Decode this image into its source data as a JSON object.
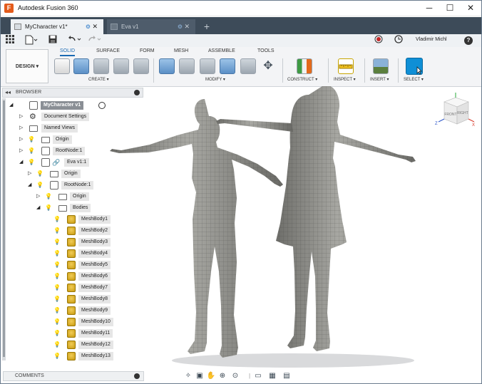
{
  "window": {
    "app_title": "Autodesk Fusion 360",
    "icon_letter": "F",
    "minimize": "─",
    "maximize": "☐",
    "close": "✕"
  },
  "tabs": [
    {
      "label": "MyCharacter v1*",
      "active": true
    },
    {
      "label": "Eva v1",
      "active": false
    }
  ],
  "tab_add": "+",
  "quick_access": {
    "user": "Vladimir Michl",
    "help": "?"
  },
  "toolbar": {
    "workspace": "DESIGN",
    "workspace_tabs": [
      "SOLID",
      "SURFACE",
      "FORM",
      "MESH",
      "ASSEMBLE",
      "TOOLS"
    ],
    "groups": [
      "CREATE",
      "MODIFY",
      "CONSTRUCT",
      "INSPECT",
      "INSERT",
      "SELECT"
    ]
  },
  "browser": {
    "title": "BROWSER",
    "root": "MyCharacter v1",
    "items": [
      "Document Settings",
      "Named Views",
      "Origin",
      "RootNode:1",
      "Eva v1:1",
      "Origin",
      "RootNode:1",
      "Origin",
      "Bodies"
    ],
    "bodies": [
      "MeshBody1",
      "MeshBody2",
      "MeshBody3",
      "MeshBody4",
      "MeshBody5",
      "MeshBody6",
      "MeshBody7",
      "MeshBody8",
      "MeshBody9",
      "MeshBody10",
      "MeshBody11",
      "MeshBody12",
      "MeshBody13"
    ]
  },
  "comments": {
    "label": "COMMENTS"
  },
  "viewcube": {
    "front": "FRONT",
    "right": "RIGHT",
    "z": "Z",
    "x": "X"
  },
  "colors": {
    "accent": "#1a6ab3",
    "tabbar": "#3d4b59",
    "bulb": "#e5b800",
    "body_icon": "#d9ac2a",
    "mesh": "#8c8c88"
  }
}
